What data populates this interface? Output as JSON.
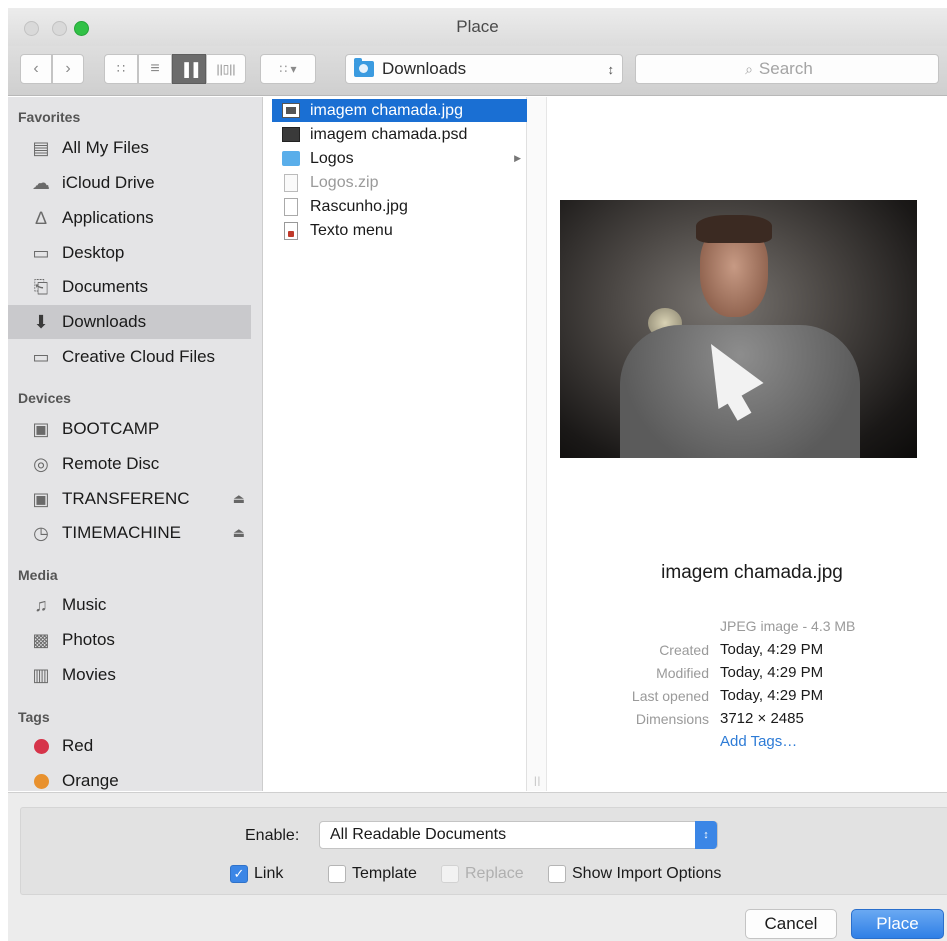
{
  "window": {
    "title": "Place"
  },
  "toolbar": {
    "location": "Downloads",
    "search_placeholder": "Search"
  },
  "sidebar": {
    "favorites_header": "Favorites",
    "favorites": [
      {
        "label": "All My Files",
        "icon": "all-files-icon"
      },
      {
        "label": "iCloud Drive",
        "icon": "cloud-icon"
      },
      {
        "label": "Applications",
        "icon": "applications-icon"
      },
      {
        "label": "Desktop",
        "icon": "desktop-icon"
      },
      {
        "label": "Documents",
        "icon": "documents-icon"
      },
      {
        "label": "Downloads",
        "icon": "downloads-icon",
        "selected": true
      },
      {
        "label": "Creative Cloud Files",
        "icon": "folder-icon"
      }
    ],
    "devices_header": "Devices",
    "devices": [
      {
        "label": "BOOTCAMP",
        "icon": "disk-icon"
      },
      {
        "label": "Remote Disc",
        "icon": "disc-icon"
      },
      {
        "label": "TRANSFERENC",
        "icon": "disk-icon",
        "eject": true
      },
      {
        "label": "TIMEMACHINE",
        "icon": "timemachine-icon",
        "eject": true
      }
    ],
    "media_header": "Media",
    "media": [
      {
        "label": "Music",
        "icon": "music-icon"
      },
      {
        "label": "Photos",
        "icon": "camera-icon"
      },
      {
        "label": "Movies",
        "icon": "film-icon"
      }
    ],
    "tags_header": "Tags",
    "tags": [
      {
        "label": "Red",
        "color": "#d6344a"
      },
      {
        "label": "Orange",
        "color": "#e8912e"
      }
    ]
  },
  "files": [
    {
      "name": "imagem chamada.jpg",
      "type": "image",
      "selected": true
    },
    {
      "name": "imagem chamada.psd",
      "type": "psd"
    },
    {
      "name": "Logos",
      "type": "folder"
    },
    {
      "name": "Logos.zip",
      "type": "zip",
      "dimmed": true
    },
    {
      "name": "Rascunho.jpg",
      "type": "doc"
    },
    {
      "name": "Texto menu",
      "type": "text"
    }
  ],
  "preview": {
    "name": "imagem chamada.jpg",
    "kind": "JPEG image - 4.3 MB",
    "created_label": "Created",
    "created": "Today, 4:29 PM",
    "modified_label": "Modified",
    "modified": "Today, 4:29 PM",
    "opened_label": "Last opened",
    "opened": "Today, 4:29 PM",
    "dimensions_label": "Dimensions",
    "dimensions": "3712 × 2485",
    "add_tags": "Add Tags…"
  },
  "options": {
    "enable_label": "Enable:",
    "enable_value": "All Readable Documents",
    "link_label": "Link",
    "link_checked": true,
    "template_label": "Template",
    "replace_label": "Replace",
    "show_import_label": "Show Import Options"
  },
  "buttons": {
    "cancel": "Cancel",
    "place": "Place"
  }
}
